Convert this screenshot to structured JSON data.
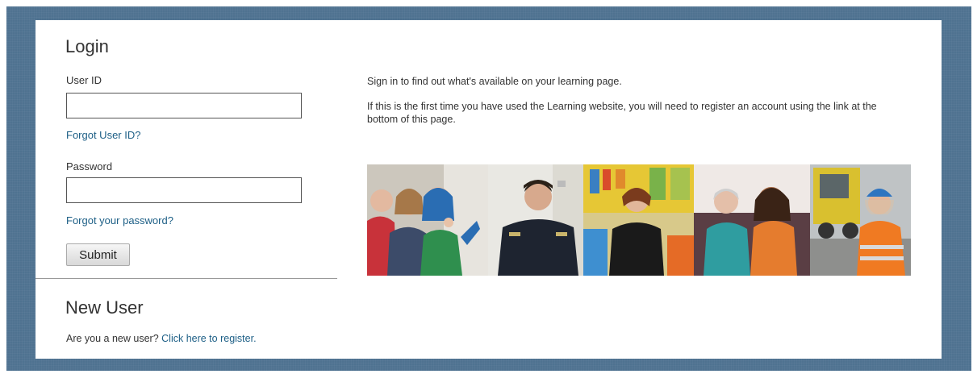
{
  "login": {
    "title": "Login",
    "user_id_label": "User ID",
    "user_id_value": "",
    "forgot_user_id": "Forgot User ID?",
    "password_label": "Password",
    "password_value": "",
    "forgot_password": "Forgot your password?",
    "submit_label": "Submit"
  },
  "new_user": {
    "title": "New User",
    "prompt": "Are you a new user?",
    "register_link": "Click here to register."
  },
  "info": {
    "line1": "Sign in to find out what's available on your learning page.",
    "line2": "If this is the first time you have used the Learning website, you will need to register an account using the link at the bottom of this page."
  },
  "colors": {
    "frame": "#4f7290",
    "link": "#1d5f86"
  },
  "photo_strip": [
    "smiling-young-people-photo",
    "uniformed-officer-photo",
    "teacher-in-classroom-photo",
    "two-women-on-sofa-photo",
    "construction-worker-photo"
  ]
}
